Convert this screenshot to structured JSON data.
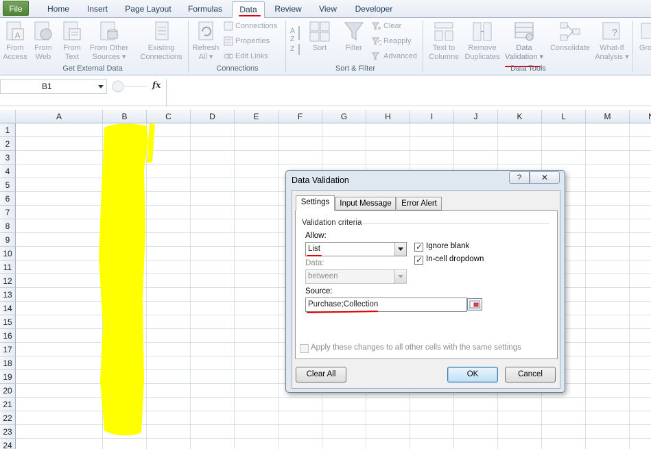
{
  "tabs": [
    {
      "label": "File"
    },
    {
      "label": "Home"
    },
    {
      "label": "Insert"
    },
    {
      "label": "Page Layout"
    },
    {
      "label": "Formulas"
    },
    {
      "label": "Data"
    },
    {
      "label": "Review"
    },
    {
      "label": "View"
    },
    {
      "label": "Developer"
    }
  ],
  "ribbon": {
    "get_external": {
      "from_access": [
        "From",
        "Access"
      ],
      "from_web": [
        "From",
        "Web"
      ],
      "from_text": [
        "From",
        "Text"
      ],
      "from_other": [
        "From Other",
        "Sources"
      ],
      "existing": [
        "Existing",
        "Connections"
      ],
      "label": "Get External Data"
    },
    "connections": {
      "refresh": [
        "Refresh",
        "All"
      ],
      "items": [
        "Connections",
        "Properties",
        "Edit Links"
      ],
      "label": "Connections"
    },
    "sort_filter": {
      "sort": "Sort",
      "filter": "Filter",
      "items": [
        "Clear",
        "Reapply",
        "Advanced"
      ],
      "label": "Sort & Filter"
    },
    "data_tools": {
      "text_to_columns": [
        "Text to",
        "Columns"
      ],
      "remove_duplicates": [
        "Remove",
        "Duplicates"
      ],
      "data_validation": [
        "Data",
        "Validation"
      ],
      "consolidate": "Consolidate",
      "what_if": [
        "What-If",
        "Analysis"
      ],
      "label": "Data Tools"
    },
    "outline": {
      "group": "Gro"
    }
  },
  "formula_bar": {
    "name_box": "B1",
    "fx": "fx",
    "value": ""
  },
  "grid": {
    "columns": [
      "A",
      "B",
      "C",
      "D",
      "E",
      "F",
      "G",
      "H",
      "I",
      "J",
      "K",
      "L",
      "M",
      "N"
    ],
    "rows": [
      "1",
      "2",
      "3",
      "4",
      "5",
      "6",
      "7",
      "8",
      "9",
      "10",
      "11",
      "12",
      "13",
      "14",
      "15",
      "16",
      "17",
      "18",
      "19",
      "20",
      "21",
      "22",
      "23",
      "24"
    ],
    "highlight_color": "#ffff00"
  },
  "dialog": {
    "title": "Data Validation",
    "help": "?",
    "close": "✕",
    "tabs": [
      "Settings",
      "Input Message",
      "Error Alert"
    ],
    "criteria_label": "Validation criteria",
    "allow_label": "Allow:",
    "allow_value": "List",
    "ignore_blank": "Ignore blank",
    "incell_dropdown": "In-cell dropdown",
    "data_label": "Data:",
    "data_value": "between",
    "source_label": "Source:",
    "source_value": "Purchase;Collection",
    "apply_all": "Apply these changes to all other cells with the same settings",
    "clear_all": "Clear All",
    "ok": "OK",
    "cancel": "Cancel"
  },
  "annotation_color": "#e00000"
}
